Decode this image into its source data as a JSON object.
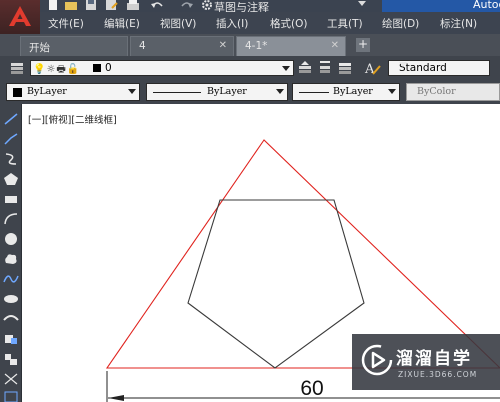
{
  "title_bar": {
    "workspace": "草图与注释",
    "app_name": "Autodesk",
    "quick_access_icons": [
      "new-file-icon",
      "open-folder-icon",
      "save-icon",
      "save-as-icon",
      "print-icon",
      "undo-icon",
      "redo-icon",
      "gear-icon"
    ]
  },
  "menu": {
    "items": [
      "文件(E)",
      "编辑(E)",
      "视图(V)",
      "插入(I)",
      "格式(O)",
      "工具(T)",
      "绘图(D)",
      "标注(N)"
    ]
  },
  "tabs": [
    {
      "label": "开始",
      "closable": false,
      "active": false
    },
    {
      "label": "4",
      "closable": true,
      "active": false
    },
    {
      "label": "4-1*",
      "closable": true,
      "active": true
    }
  ],
  "toolbar": {
    "layer_name": "0",
    "text_style": "Standard"
  },
  "properties": {
    "color": "ByLayer",
    "linetype": "ByLayer",
    "lineweight": "ByLayer",
    "plot_style": "ByColor"
  },
  "viewport": {
    "label": "[一][俯视][二维线框]"
  },
  "drawing": {
    "triangle_color": "#e0231e",
    "pentagon_color": "#3a3a3a",
    "dimension_text": "60"
  },
  "watermark": {
    "title": "溜溜自学",
    "url": "ZIXUE.3D66.COM"
  },
  "tools": [
    "line-icon",
    "polyline-icon",
    "construction-line-icon",
    "polygon-icon",
    "rectangle-icon",
    "arc-icon",
    "circle-icon",
    "revision-cloud-icon",
    "spline-icon",
    "ellipse-icon",
    "ellipse-arc-icon",
    "insert-block-icon",
    "make-block-icon",
    "point-icon",
    "hatch-icon"
  ],
  "colors": {
    "chrome_dark": "#3f444c",
    "brand_blue": "#2458a6",
    "canvas": "#ffffff"
  }
}
